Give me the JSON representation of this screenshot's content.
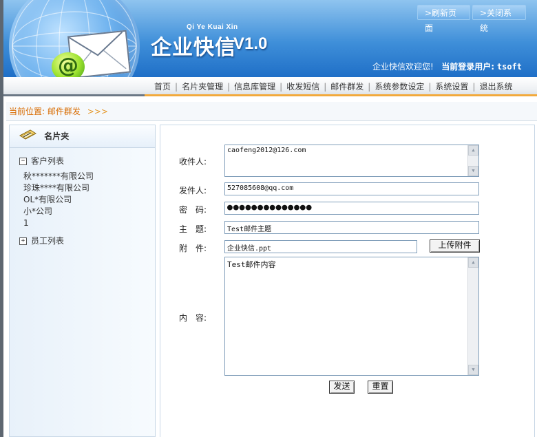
{
  "header": {
    "brand_pinyin": "Qi Ye Kuai Xin",
    "brand_name": "企业快信",
    "brand_version": "V1.0",
    "refresh_label": ">刷新页面",
    "close_label": ">关闭系统",
    "welcome_text": "企业快信欢迎您!",
    "login_label": "当前登录用户:",
    "login_user": "tsoft"
  },
  "nav": {
    "items": [
      "首页",
      "名片夹管理",
      "信息库管理",
      "收发短信",
      "邮件群发",
      "系统参数设定",
      "系统设置",
      "退出系统"
    ]
  },
  "breadcrumb": {
    "label": "当前位置:",
    "current": "邮件群发",
    "arrows": ">>>"
  },
  "sidebar": {
    "title": "名片夹",
    "groups": [
      {
        "label": "客户列表",
        "toggle": "−",
        "items": [
          "秋*******有限公司",
          "珍珠****有限公司",
          "OL*有限公司",
          "小*公司",
          "1"
        ]
      },
      {
        "label": "员工列表",
        "toggle": "+",
        "items": []
      }
    ]
  },
  "form": {
    "to_label": "收件人:",
    "to_value": "caofeng2012@126.com",
    "from_label": "发件人:",
    "from_value": "527085608@qq.com",
    "password_label": "密　码:",
    "password_value": "●●●●●●●●●●●●●●",
    "subject_label": "主　题:",
    "subject_value": "Test邮件主题",
    "attach_label": "附　件:",
    "attach_value": "企业快信.ppt",
    "upload_label": "上传附件",
    "content_label": "内　容:",
    "content_value": "Test邮件内容",
    "send_label": "发送",
    "reset_label": "重置"
  },
  "colors": {
    "accent_orange": "#f2a93b",
    "breadcrumb_text": "#d86b00",
    "header_blue": "#1f6fc7",
    "input_border": "#7f9db9"
  }
}
